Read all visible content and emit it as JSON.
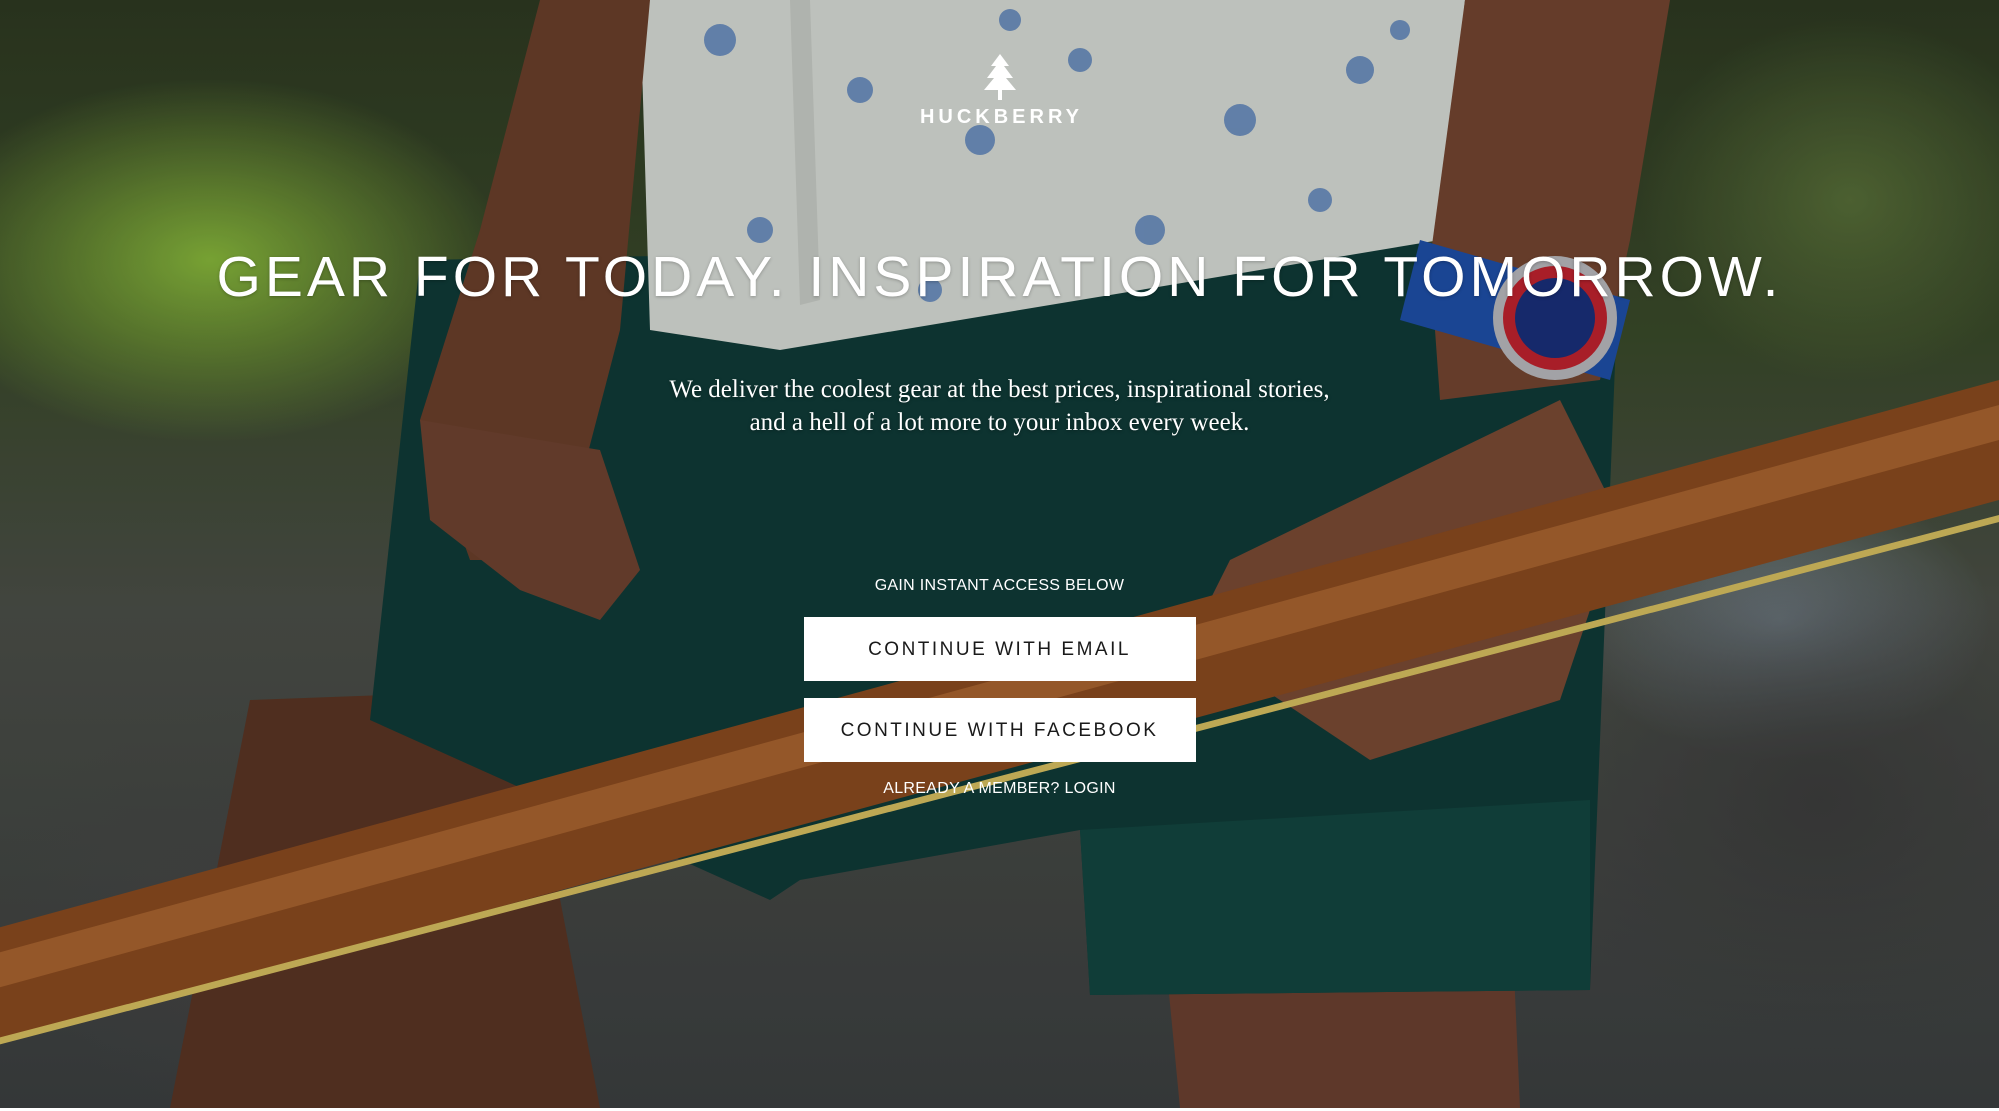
{
  "brand": {
    "name": "HUCKBERRY",
    "logo_icon": "pine-tree-icon"
  },
  "hero": {
    "headline": "GEAR FOR TODAY. INSPIRATION FOR TOMORROW.",
    "subtext_line1": "We deliver the coolest gear at the best prices, inspirational stories,",
    "subtext_line2": "and a hell of a lot more to your inbox every week."
  },
  "signup": {
    "access_label": "GAIN INSTANT ACCESS BELOW",
    "email_button": "CONTINUE WITH EMAIL",
    "facebook_button": "CONTINUE WITH FACEBOOK",
    "login_link": "ALREADY A MEMBER? LOGIN"
  },
  "colors": {
    "text": "#ffffff",
    "button_bg": "#ffffff",
    "button_text": "#1a1a1a"
  }
}
